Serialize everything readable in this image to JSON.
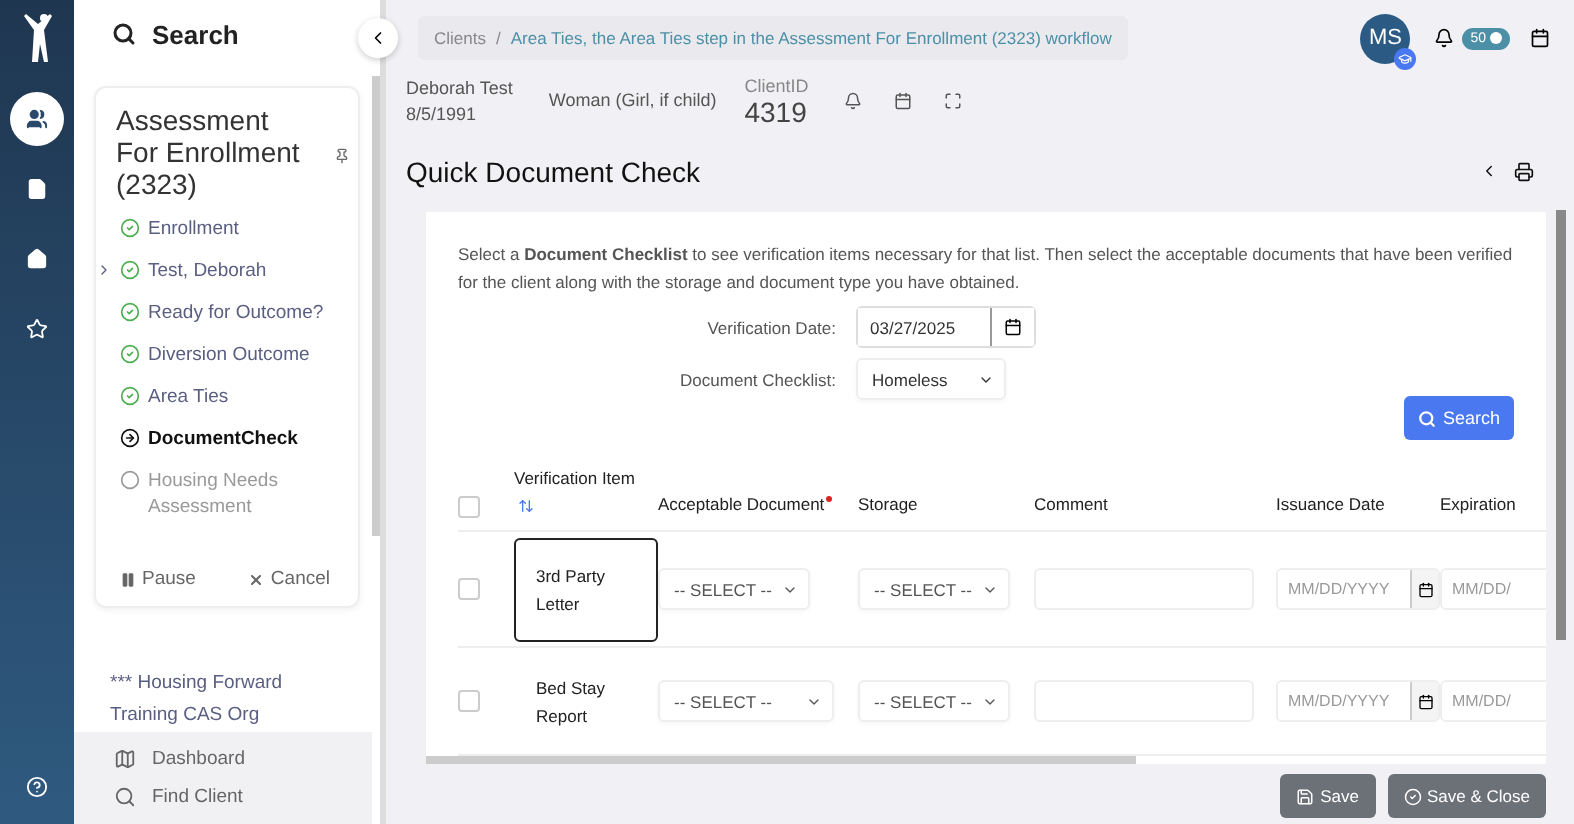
{
  "rail": {
    "items": [
      {
        "kind": "people",
        "selected": true
      },
      {
        "kind": "document",
        "selected": false
      },
      {
        "kind": "home",
        "selected": false
      },
      {
        "kind": "star",
        "selected": false
      }
    ]
  },
  "sidebar": {
    "search_label": "Search",
    "workflow": {
      "title": "Assessment For Enrollment (2323)",
      "steps": [
        {
          "label": "Enrollment",
          "completed": true,
          "current": false,
          "expandable": false
        },
        {
          "label": "Test, Deborah",
          "completed": true,
          "current": false,
          "expandable": true
        },
        {
          "label": "Ready for Outcome?",
          "completed": true,
          "current": false,
          "expandable": false
        },
        {
          "label": "Diversion Outcome",
          "completed": true,
          "current": false,
          "expandable": false
        },
        {
          "label": "Area Ties",
          "completed": true,
          "current": false,
          "expandable": false
        },
        {
          "label": "DocumentCheck",
          "completed": false,
          "current": true,
          "expandable": false
        },
        {
          "label": "Housing Needs Assessment",
          "completed": false,
          "current": false,
          "expandable": false
        }
      ],
      "pause": "Pause",
      "cancel": "Cancel"
    },
    "org": "*** Housing Forward Training CAS Org",
    "nav_links": [
      {
        "kind": "map",
        "label": "Dashboard"
      },
      {
        "kind": "search",
        "label": "Find Client"
      }
    ]
  },
  "breadcrumb": {
    "separator": "/",
    "items": [
      "Clients",
      "Area Ties, the Area Ties step in the Assessment For Enrollment (2323) workflow"
    ]
  },
  "user": {
    "initials": "MS",
    "notification_count": "50"
  },
  "client": {
    "name": "Deborah Test",
    "dob": "8/5/1991",
    "gender": "Woman (Girl, if child)",
    "id_label": "ClientID",
    "id": "4319"
  },
  "page_title": "Quick Document Check",
  "instructions": "Select a **Document Checklist** to see verification items necessary for that list.  Then select the acceptable documents that have been verified for the client along with the storage and document type you have obtained.",
  "fields": [
    {
      "kind": "date",
      "label": "Verification Date:",
      "value": "03/27/2025"
    },
    {
      "kind": "select",
      "label": "Document Checklist:",
      "value": "Homeless"
    }
  ],
  "search_button": "Search",
  "table": {
    "select_all_checked": false,
    "columns": [
      {
        "label": "Verification Item",
        "sortable": true,
        "required": false
      },
      {
        "label": "Acceptable Document",
        "sortable": false,
        "required": true
      },
      {
        "label": "Storage",
        "sortable": false,
        "required": false
      },
      {
        "label": "Comment",
        "sortable": false,
        "required": false
      },
      {
        "label": "Issuance Date",
        "sortable": false,
        "required": false
      },
      {
        "label": "Expiration",
        "sortable": false,
        "required": false
      }
    ],
    "rows": [
      {
        "item": "3rd Party Letter",
        "focused": true,
        "checked": false,
        "acceptable": "-- SELECT --",
        "storage": "-- SELECT --",
        "issuance_placeholder": "MM/DD/YYYY",
        "expiration_placeholder": "MM/DD/"
      },
      {
        "item": "Bed Stay Report",
        "focused": false,
        "checked": false,
        "acceptable": "-- SELECT --",
        "storage": "-- SELECT --",
        "issuance_placeholder": "MM/DD/YYYY",
        "expiration_placeholder": "MM/DD/"
      }
    ]
  },
  "footer_buttons": [
    {
      "kind": "save",
      "label": "Save"
    },
    {
      "kind": "save_close",
      "label": "Save & Close"
    }
  ]
}
